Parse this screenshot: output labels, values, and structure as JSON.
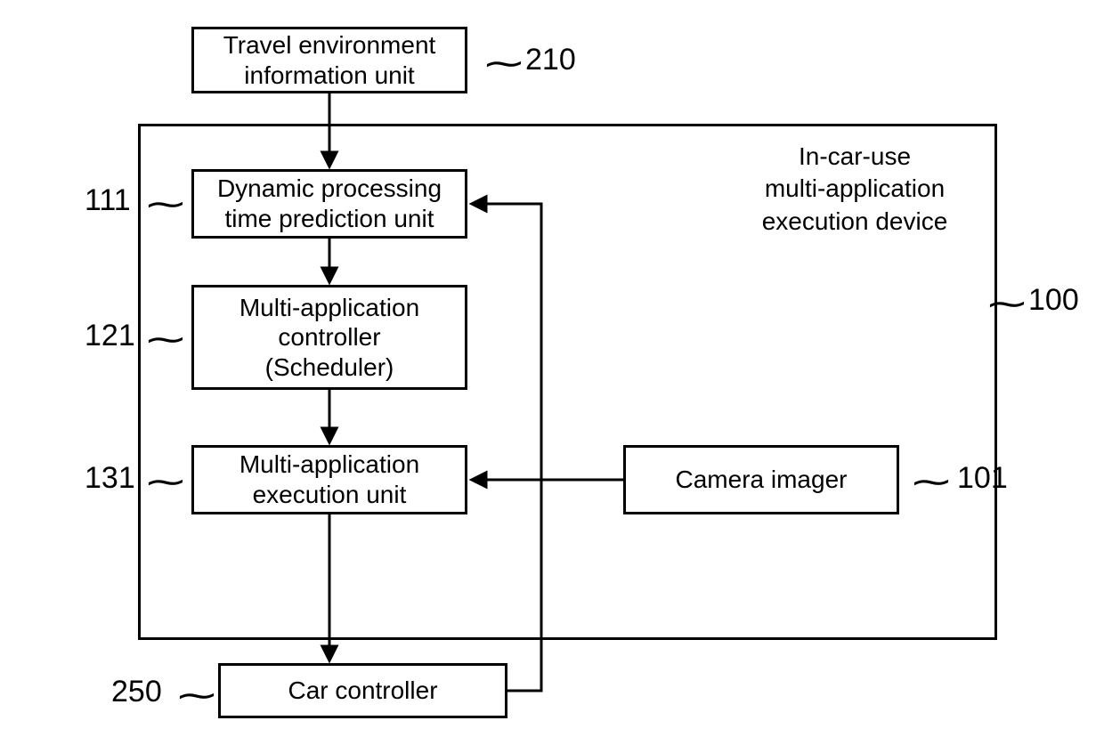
{
  "blocks": {
    "travel_env": "Travel environment\ninformation unit",
    "dynamic_proc": "Dynamic processing\ntime prediction unit",
    "multi_ctrl": "Multi-application\ncontroller\n(Scheduler)",
    "multi_exec": "Multi-application\nexecution unit",
    "camera": "Camera imager",
    "car_ctrl": "Car controller"
  },
  "device_label": "In-car-use\nmulti-application\nexecution device",
  "refs": {
    "travel_env": "210",
    "dynamic_proc": "111",
    "multi_ctrl": "121",
    "multi_exec": "131",
    "camera": "101",
    "car_ctrl": "250",
    "device": "100"
  }
}
